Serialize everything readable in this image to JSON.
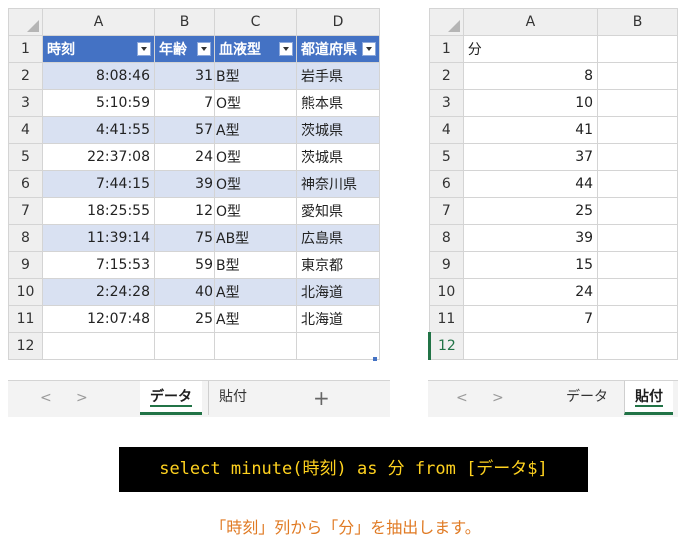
{
  "left_sheet": {
    "columns": [
      "A",
      "B",
      "C",
      "D"
    ],
    "headers": [
      "時刻",
      "年齢",
      "血液型",
      "都道府県"
    ],
    "rows": [
      [
        "2",
        "8:08:46",
        "31",
        "B型",
        "岩手県"
      ],
      [
        "3",
        "5:10:59",
        "7",
        "O型",
        "熊本県"
      ],
      [
        "4",
        "4:41:55",
        "57",
        "A型",
        "茨城県"
      ],
      [
        "5",
        "22:37:08",
        "24",
        "O型",
        "茨城県"
      ],
      [
        "6",
        "7:44:15",
        "39",
        "O型",
        "神奈川県"
      ],
      [
        "7",
        "18:25:55",
        "12",
        "O型",
        "愛知県"
      ],
      [
        "8",
        "11:39:14",
        "75",
        "AB型",
        "広島県"
      ],
      [
        "9",
        "7:15:53",
        "59",
        "B型",
        "東京都"
      ],
      [
        "10",
        "2:24:28",
        "40",
        "A型",
        "北海道"
      ],
      [
        "11",
        "12:07:48",
        "25",
        "A型",
        "北海道"
      ]
    ],
    "header_row_num": "1",
    "empty_row_num": "12",
    "tabs": [
      "データ",
      "貼付"
    ],
    "active_tab": "データ",
    "nav_prev": "<",
    "nav_next": ">",
    "add_sheet": "+"
  },
  "right_sheet": {
    "columns": [
      "A",
      "B"
    ],
    "header_row_num": "1",
    "header": "分",
    "rows": [
      [
        "2",
        "8"
      ],
      [
        "3",
        "10"
      ],
      [
        "4",
        "41"
      ],
      [
        "5",
        "37"
      ],
      [
        "6",
        "44"
      ],
      [
        "7",
        "25"
      ],
      [
        "8",
        "39"
      ],
      [
        "9",
        "15"
      ],
      [
        "10",
        "24"
      ],
      [
        "11",
        "7"
      ]
    ],
    "empty_row_num": "12",
    "tabs": [
      "データ",
      "貼付"
    ],
    "active_tab": "貼付",
    "nav_prev": "<",
    "nav_next": ">"
  },
  "sql": "select minute(時刻) as 分 from [データ$]",
  "caption": "「時刻」列から「分」を抽出します。",
  "colors": {
    "header_fill": "#4472c4",
    "band_fill": "#d9e1f2",
    "code_bg": "#000000",
    "code_text": "#ffd21f",
    "caption_text": "#e07a23",
    "tab_accent": "#217346"
  }
}
